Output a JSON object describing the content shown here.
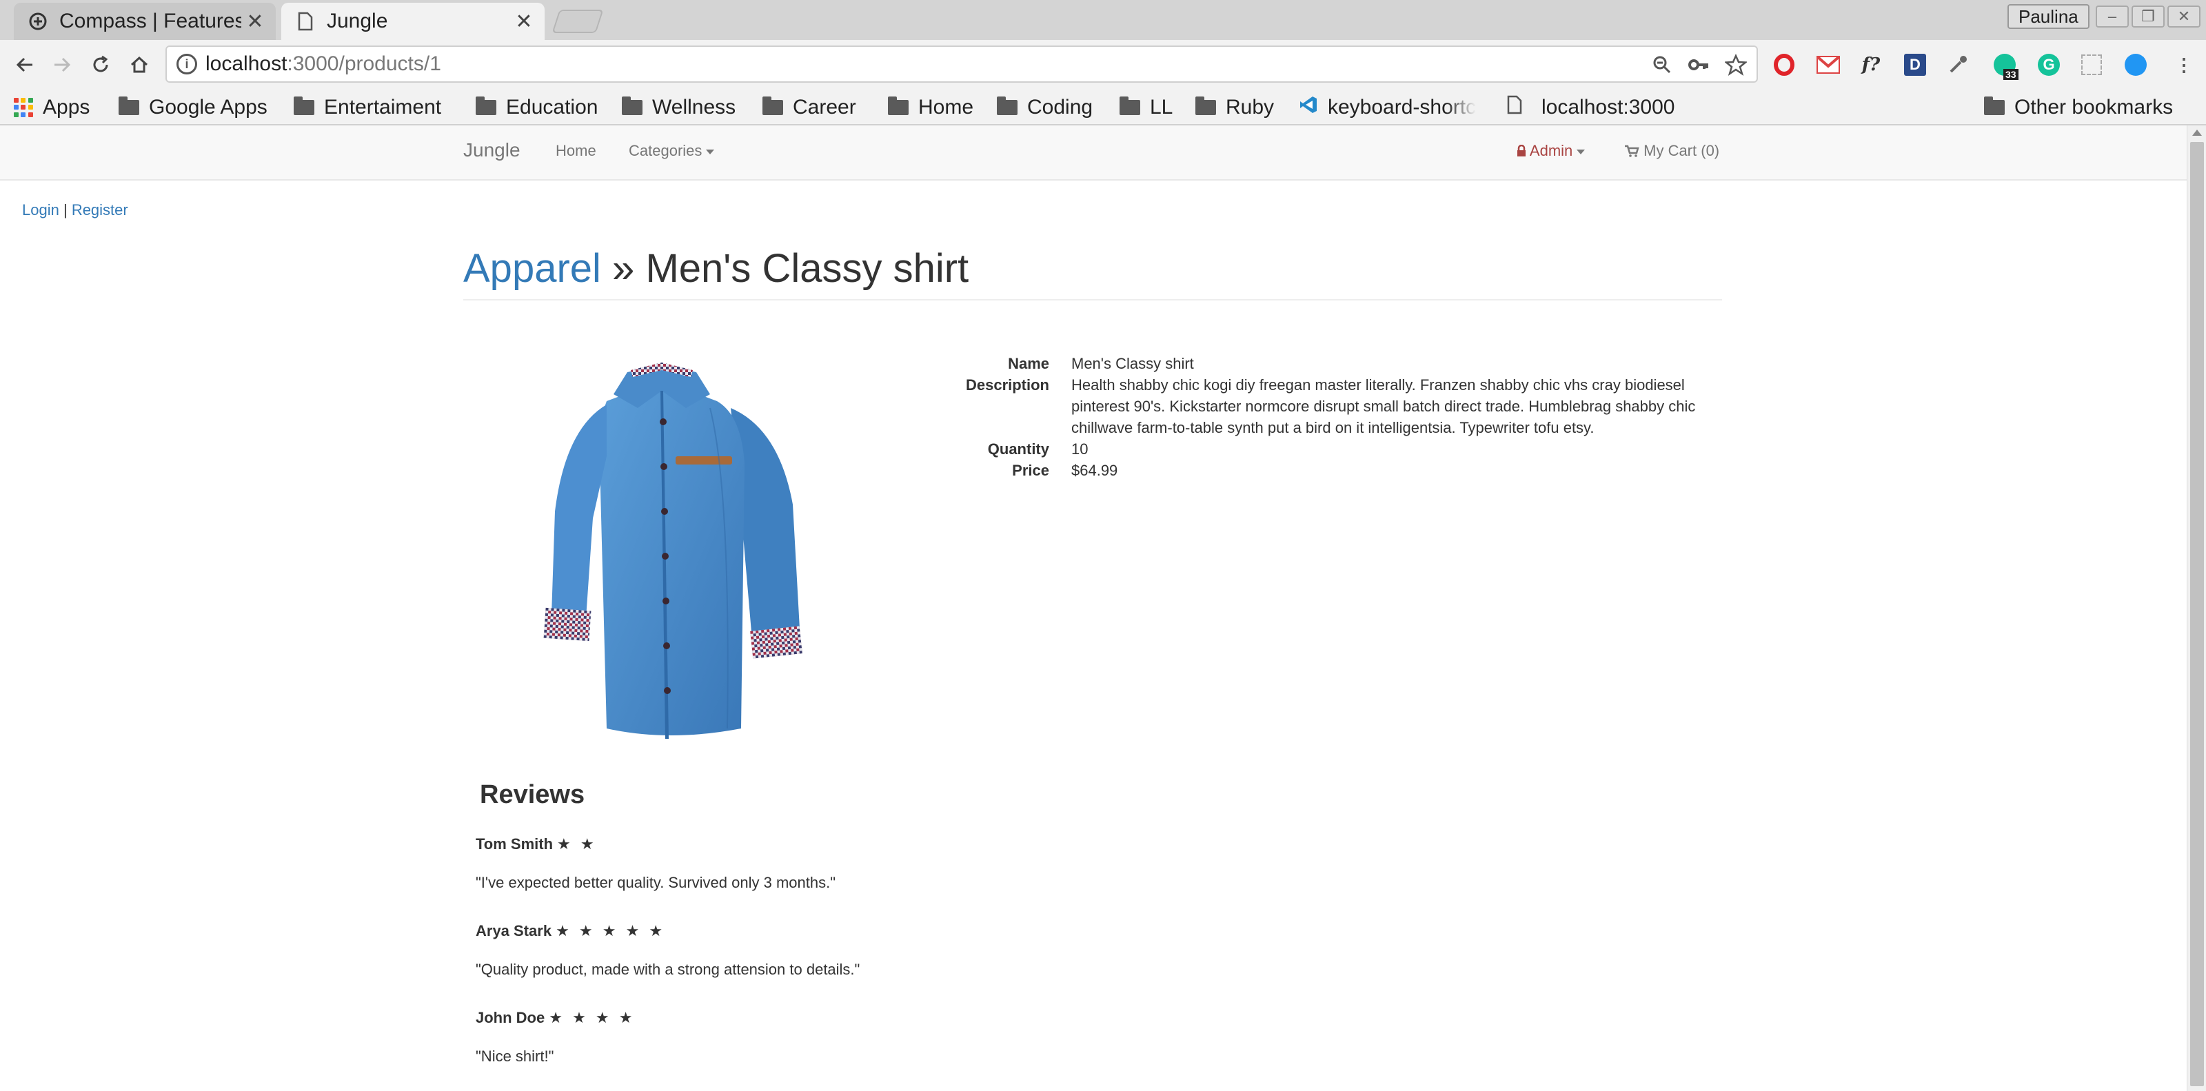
{
  "browser": {
    "tabs": [
      {
        "title": "Compass | Features",
        "active": false
      },
      {
        "title": "Jungle",
        "active": true
      }
    ],
    "profile_name": "Paulina",
    "url_host": "localhost",
    "url_rest": ":3000/products/1",
    "extension_badge": "33",
    "bookmarks": [
      {
        "label": "Apps",
        "icon": "apps-grid-icon"
      },
      {
        "label": "Google Apps",
        "icon": "folder-icon"
      },
      {
        "label": "Entertaiment",
        "icon": "folder-icon"
      },
      {
        "label": "Education",
        "icon": "folder-icon"
      },
      {
        "label": "Wellness",
        "icon": "folder-icon"
      },
      {
        "label": "Career",
        "icon": "folder-icon"
      },
      {
        "label": "Home",
        "icon": "folder-icon"
      },
      {
        "label": "Coding",
        "icon": "folder-icon"
      },
      {
        "label": "LL",
        "icon": "folder-icon"
      },
      {
        "label": "Ruby",
        "icon": "folder-icon"
      },
      {
        "label": "keyboard-shortc",
        "icon": "vscode-icon"
      },
      {
        "label": "localhost:3000",
        "icon": "page-icon"
      },
      {
        "label": "Other bookmarks",
        "icon": "folder-icon"
      }
    ]
  },
  "site": {
    "brand": "Jungle",
    "nav": {
      "home": "Home",
      "categories": "Categories",
      "admin": "Admin",
      "cart": "My Cart (0)"
    },
    "auth": {
      "login": "Login",
      "separator": "|",
      "register": "Register"
    }
  },
  "product": {
    "category": "Apparel",
    "separator": "»",
    "title": "Men's Classy shirt",
    "labels": {
      "name": "Name",
      "description": "Description",
      "quantity": "Quantity",
      "price": "Price"
    },
    "name": "Men's Classy shirt",
    "description": "Health shabby chic kogi diy freegan master literally. Franzen shabby chic vhs cray biodiesel pinterest 90's. Kickstarter normcore disrupt small batch direct trade. Humblebrag shabby chic chillwave farm-to-table synth put a bird on it intelligentsia. Typewriter tofu etsy.",
    "quantity": "10",
    "price": "$64.99",
    "image_color": "#4a8fcf"
  },
  "reviews": {
    "heading": "Reviews",
    "items": [
      {
        "author": "Tom Smith",
        "stars": "★ ★",
        "rating": 2,
        "text": "\"I've expected better quality. Survived only 3 months.\""
      },
      {
        "author": "Arya Stark",
        "stars": "★ ★ ★ ★ ★",
        "rating": 5,
        "text": "\"Quality product, made with a strong attension to details.\""
      },
      {
        "author": "John Doe",
        "stars": "★ ★ ★ ★",
        "rating": 4,
        "text": "\"Nice shirt!\""
      }
    ]
  }
}
